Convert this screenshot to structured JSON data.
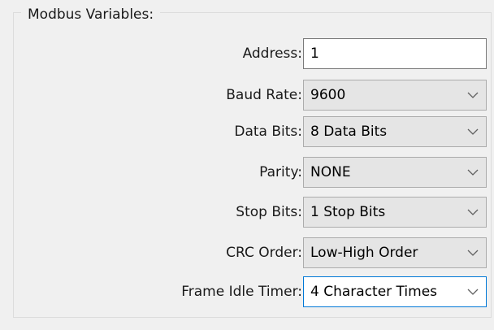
{
  "group": {
    "title": "Modbus Variables:"
  },
  "fields": {
    "address": {
      "label": "Address:",
      "value": "1"
    },
    "baud_rate": {
      "label": "Baud Rate:",
      "value": "9600"
    },
    "data_bits": {
      "label": "Data Bits:",
      "value": "8 Data Bits"
    },
    "parity": {
      "label": "Parity:",
      "value": "NONE"
    },
    "stop_bits": {
      "label": "Stop Bits:",
      "value": "1 Stop Bits"
    },
    "crc_order": {
      "label": "CRC Order:",
      "value": "Low-High Order"
    },
    "frame_idle_timer": {
      "label": "Frame Idle Timer:",
      "value": "4 Character Times"
    }
  },
  "icons": {
    "dropdown": "chevron-down-icon"
  },
  "colors": {
    "focus_border": "#0078d7",
    "combo_background": "#e5e5e5",
    "window_background": "#f0f0f0"
  }
}
